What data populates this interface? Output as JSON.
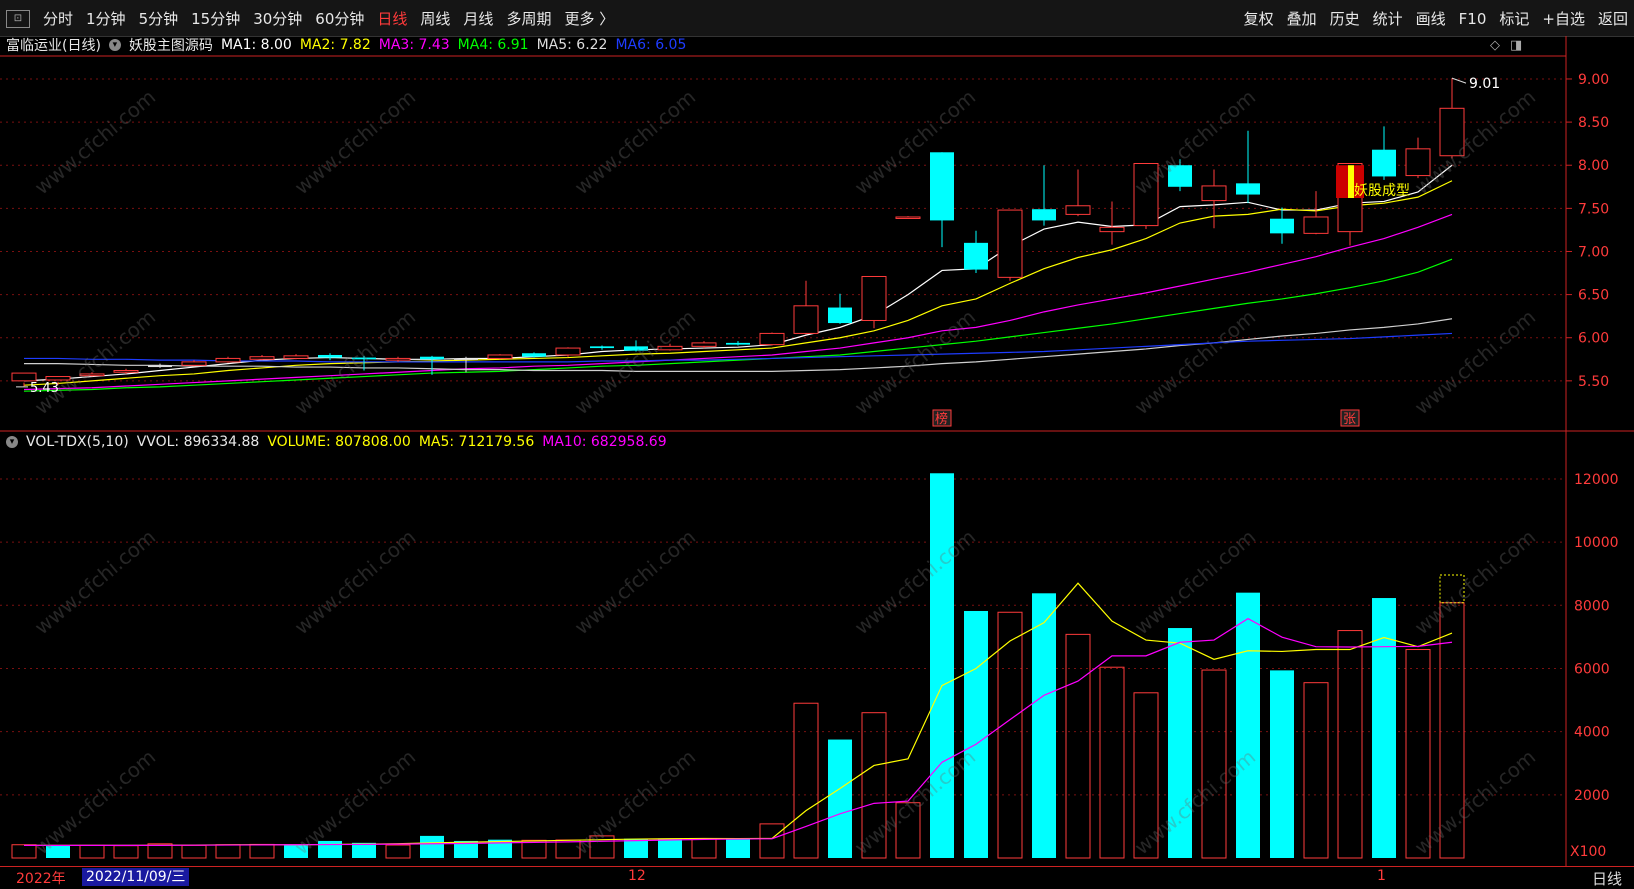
{
  "toolbar": {
    "left_icon": "⊡",
    "periods": [
      "分时",
      "1分钟",
      "5分钟",
      "15分钟",
      "30分钟",
      "60分钟",
      "日线",
      "周线",
      "月线",
      "多周期",
      "更多 〉"
    ],
    "active_index": 6,
    "right": [
      "复权",
      "叠加",
      "历史",
      "统计",
      "画线",
      "F10",
      "标记",
      "+自选",
      "返回"
    ]
  },
  "price_panel": {
    "stock": "富临运业(日线)",
    "indicator": "妖股主图源码",
    "mas": [
      {
        "label": "MA1: 8.00",
        "color": "#ffffff"
      },
      {
        "label": "MA2: 7.82",
        "color": "#ffff00"
      },
      {
        "label": "MA3: 7.43",
        "color": "#ff00ff"
      },
      {
        "label": "MA4: 6.91",
        "color": "#00ff00"
      },
      {
        "label": "MA5: 6.22",
        "color": "#dddddd"
      },
      {
        "label": "MA6: 6.05",
        "color": "#1e3cff"
      }
    ],
    "y_ticks": [
      "9.00",
      "8.50",
      "8.00",
      "7.50",
      "7.00",
      "6.50",
      "6.00",
      "5.50"
    ],
    "high_label": "9.01",
    "low_label": "5.43",
    "signal_text": "妖股成型",
    "marker_bang": "榜",
    "marker_zhang": "张"
  },
  "volume_panel": {
    "title": "VOL-TDX(5,10)",
    "vvol": "VVOL: 896334.88",
    "volume": "VOLUME: 807808.00",
    "ma5": "MA5: 712179.56",
    "ma10": "MA10: 682958.69",
    "y_ticks": [
      "12000",
      "10000",
      "8000",
      "6000",
      "4000",
      "2000"
    ],
    "unit": "X100"
  },
  "bottom": {
    "year": "2022年",
    "date": "2022/11/09/三",
    "month_12": "12",
    "month_1": "1",
    "period": "日线"
  },
  "watermark": "www.cfchi.com",
  "chart_data": {
    "type": "candlestick",
    "candles": [
      [
        5.5,
        5.59,
        5.48,
        5.43,
        "up"
      ],
      [
        5.51,
        5.55,
        5.49,
        5.45,
        "up"
      ],
      [
        5.58,
        5.56,
        5.6,
        5.55,
        "up"
      ],
      [
        5.62,
        5.6,
        5.64,
        5.58,
        "up"
      ],
      [
        5.68,
        5.66,
        5.7,
        5.65,
        "flat"
      ],
      [
        5.72,
        5.68,
        5.74,
        5.67,
        "up"
      ],
      [
        5.76,
        5.72,
        5.78,
        5.71,
        "up"
      ],
      [
        5.78,
        5.75,
        5.8,
        5.74,
        "up"
      ],
      [
        5.79,
        5.76,
        5.81,
        5.75,
        "up"
      ],
      [
        5.77,
        5.8,
        5.82,
        5.74,
        "down"
      ],
      [
        5.75,
        5.77,
        5.79,
        5.62,
        "down"
      ],
      [
        5.76,
        5.74,
        5.78,
        5.72,
        "up"
      ],
      [
        5.75,
        5.78,
        5.79,
        5.57,
        "down"
      ],
      [
        5.76,
        5.75,
        5.78,
        5.6,
        "flat"
      ],
      [
        5.8,
        5.76,
        5.81,
        5.75,
        "up"
      ],
      [
        5.82,
        5.78,
        5.83,
        5.77,
        "down"
      ],
      [
        5.88,
        5.8,
        5.89,
        5.78,
        "up"
      ],
      [
        5.9,
        5.88,
        5.91,
        5.86,
        "down"
      ],
      [
        5.9,
        5.85,
        5.97,
        5.84,
        "down"
      ],
      [
        5.9,
        5.86,
        5.93,
        5.85,
        "up"
      ],
      [
        5.94,
        5.9,
        5.96,
        5.88,
        "up"
      ],
      [
        5.94,
        5.92,
        5.96,
        5.91,
        "down"
      ],
      [
        6.05,
        5.92,
        6.06,
        5.91,
        "up"
      ],
      [
        6.37,
        6.05,
        6.66,
        6.04,
        "up"
      ],
      [
        6.35,
        6.17,
        6.51,
        6.16,
        "down"
      ],
      [
        6.71,
        6.2,
        6.71,
        6.11,
        "up"
      ],
      [
        7.4,
        7.4,
        7.41,
        7.39,
        "up"
      ],
      [
        8.15,
        7.36,
        8.15,
        7.05,
        "down"
      ],
      [
        7.1,
        6.79,
        7.24,
        6.75,
        "down"
      ],
      [
        7.48,
        6.7,
        7.48,
        6.66,
        "up"
      ],
      [
        7.49,
        7.36,
        8.0,
        7.3,
        "down"
      ],
      [
        7.53,
        7.43,
        7.95,
        7.41,
        "up"
      ],
      [
        7.28,
        7.23,
        7.58,
        7.08,
        "up"
      ],
      [
        8.02,
        7.3,
        8.02,
        7.26,
        "up"
      ],
      [
        8.0,
        7.75,
        8.07,
        7.7,
        "down"
      ],
      [
        7.76,
        7.59,
        7.95,
        7.27,
        "up"
      ],
      [
        7.79,
        7.66,
        8.4,
        7.56,
        "down"
      ],
      [
        7.38,
        7.21,
        7.51,
        7.09,
        "down"
      ],
      [
        7.4,
        7.21,
        7.7,
        7.2,
        "up"
      ],
      [
        8.02,
        7.23,
        8.02,
        7.07,
        "up"
      ],
      [
        8.18,
        7.87,
        8.45,
        7.83,
        "down"
      ],
      [
        8.19,
        7.88,
        8.32,
        7.85,
        "up"
      ],
      [
        8.66,
        8.11,
        9.01,
        8.08,
        "up"
      ]
    ],
    "volumes_x100": [
      420,
      380,
      400,
      390,
      450,
      400,
      420,
      430,
      420,
      540,
      480,
      410,
      700,
      540,
      580,
      560,
      570,
      700,
      610,
      620,
      610,
      600,
      1080,
      4900,
      3750,
      4600,
      1750,
      12180,
      7820,
      7780,
      8380,
      7080,
      6040,
      5230,
      7280,
      5950,
      8400,
      5940,
      5550,
      7200,
      8230,
      6600,
      8080
    ],
    "volume_dir": [
      "up",
      "down",
      "up",
      "up",
      "up",
      "up",
      "up",
      "up",
      "down",
      "down",
      "down",
      "up",
      "down",
      "down",
      "down",
      "up",
      "up",
      "up",
      "down",
      "down",
      "up",
      "down",
      "up",
      "up",
      "down",
      "up",
      "up",
      "down",
      "down",
      "up",
      "down",
      "up",
      "up",
      "up",
      "down",
      "up",
      "down",
      "down",
      "up",
      "up",
      "down",
      "up",
      "up"
    ],
    "ma_lines": {
      "MA1": [
        5.5,
        5.52,
        5.55,
        5.58,
        5.62,
        5.66,
        5.7,
        5.74,
        5.76,
        5.77,
        5.76,
        5.75,
        5.75,
        5.76,
        5.76,
        5.78,
        5.8,
        5.84,
        5.86,
        5.87,
        5.88,
        5.89,
        5.92,
        6.03,
        6.12,
        6.26,
        6.5,
        6.78,
        6.8,
        7.06,
        7.26,
        7.34,
        7.29,
        7.31,
        7.52,
        7.54,
        7.57,
        7.48,
        7.48,
        7.56,
        7.58,
        7.69,
        8.0
      ],
      "MA2": [
        5.45,
        5.47,
        5.5,
        5.53,
        5.56,
        5.58,
        5.62,
        5.65,
        5.68,
        5.7,
        5.71,
        5.72,
        5.73,
        5.74,
        5.75,
        5.76,
        5.77,
        5.79,
        5.81,
        5.82,
        5.84,
        5.86,
        5.88,
        5.94,
        6.0,
        6.08,
        6.2,
        6.37,
        6.45,
        6.63,
        6.8,
        6.93,
        7.02,
        7.15,
        7.33,
        7.41,
        7.43,
        7.49,
        7.47,
        7.53,
        7.56,
        7.63,
        7.82
      ],
      "MA3": [
        5.4,
        5.41,
        5.42,
        5.44,
        5.46,
        5.48,
        5.5,
        5.52,
        5.54,
        5.56,
        5.58,
        5.6,
        5.62,
        5.64,
        5.65,
        5.67,
        5.68,
        5.7,
        5.72,
        5.74,
        5.76,
        5.78,
        5.8,
        5.84,
        5.88,
        5.94,
        6.0,
        6.08,
        6.12,
        6.2,
        6.3,
        6.38,
        6.45,
        6.52,
        6.6,
        6.68,
        6.76,
        6.85,
        6.94,
        7.05,
        7.15,
        7.28,
        7.43
      ],
      "MA4": [
        5.38,
        5.39,
        5.4,
        5.42,
        5.43,
        5.45,
        5.47,
        5.49,
        5.51,
        5.53,
        5.55,
        5.57,
        5.59,
        5.6,
        5.61,
        5.63,
        5.65,
        5.67,
        5.68,
        5.7,
        5.72,
        5.74,
        5.76,
        5.78,
        5.8,
        5.84,
        5.88,
        5.92,
        5.96,
        6.01,
        6.06,
        6.11,
        6.16,
        6.22,
        6.28,
        6.34,
        6.4,
        6.45,
        6.51,
        6.58,
        6.66,
        6.76,
        6.91
      ],
      "MA5": [
        5.7,
        5.7,
        5.69,
        5.68,
        5.68,
        5.67,
        5.67,
        5.67,
        5.66,
        5.66,
        5.65,
        5.65,
        5.64,
        5.63,
        5.63,
        5.62,
        5.62,
        5.62,
        5.61,
        5.61,
        5.61,
        5.61,
        5.61,
        5.62,
        5.63,
        5.65,
        5.67,
        5.7,
        5.72,
        5.75,
        5.78,
        5.81,
        5.84,
        5.87,
        5.91,
        5.94,
        5.98,
        6.02,
        6.05,
        6.09,
        6.12,
        6.16,
        6.22
      ],
      "MA6": [
        5.76,
        5.76,
        5.75,
        5.75,
        5.74,
        5.74,
        5.73,
        5.73,
        5.73,
        5.72,
        5.72,
        5.72,
        5.72,
        5.72,
        5.72,
        5.72,
        5.72,
        5.73,
        5.73,
        5.74,
        5.74,
        5.75,
        5.76,
        5.77,
        5.78,
        5.79,
        5.8,
        5.81,
        5.82,
        5.83,
        5.84,
        5.86,
        5.88,
        5.9,
        5.92,
        5.94,
        5.96,
        5.97,
        5.98,
        5.99,
        6.01,
        6.03,
        6.05
      ]
    },
    "vol_ma5_x100": [
      400,
      400,
      400,
      400,
      405,
      410,
      415,
      420,
      420,
      430,
      440,
      450,
      480,
      500,
      520,
      540,
      560,
      580,
      600,
      610,
      620,
      615,
      620,
      1500,
      2200,
      2930,
      3140,
      5460,
      6000,
      6870,
      7450,
      8700,
      7500,
      6900,
      6800,
      6290,
      6560,
      6540,
      6600,
      6600,
      6980,
      6690,
      7120
    ],
    "vol_ma10_x100": [
      400,
      400,
      400,
      400,
      400,
      405,
      410,
      415,
      420,
      425,
      430,
      440,
      450,
      460,
      480,
      495,
      510,
      530,
      550,
      570,
      590,
      600,
      610,
      1000,
      1400,
      1730,
      1800,
      3030,
      3600,
      4380,
      5150,
      5600,
      6400,
      6400,
      6830,
      6900,
      7580,
      6990,
      6690,
      6680,
      6690,
      6700,
      6830
    ],
    "y_range": [
      5.22,
      9.22
    ],
    "vol_range_x100": [
      0,
      12600
    ]
  }
}
